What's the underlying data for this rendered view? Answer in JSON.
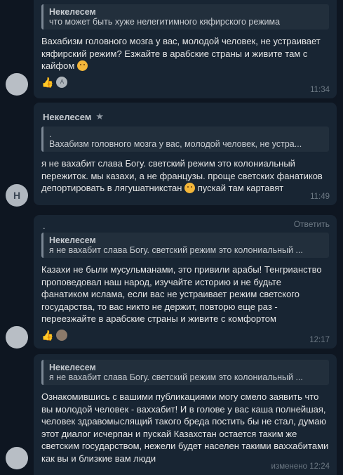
{
  "messages": [
    {
      "quote_name": "Некелесем",
      "quote_text": "что может быть хуже нелегитимного кяфирского режима",
      "text": "Вахабизм головного мозга у вас, молодой человек, не устраивает кяфирский режим? Езжайте в арабские страны и живите там с кайфом",
      "emoji": "winking-face",
      "time": "11:34",
      "reactions": [
        "👍",
        "A"
      ]
    },
    {
      "sender": "Некелесем",
      "quote_line1": ".",
      "quote_text": "Вахабизм головного мозга у вас, молодой человек, не устра...",
      "text": "я не вахабит слава Богу. светский режим это колониальный пережиток. мы казахи, а не французы. проще светских фанатиков депортировать в лягушатникстан",
      "text_after_emoji": "пускай там картавят",
      "time": "11:49",
      "avatar_letter": "Н"
    },
    {
      "reply_action": "Ответить",
      "top_dot": ".",
      "quote_name": "Некелесем",
      "quote_text": "я не вахабит слава Богу. светский режим это колониальный ...",
      "text": "Казахи не были мусульманами, это привили арабы! Тенгрианство проповедовал наш народ, изучайте историю и не будьте фанатиком ислама, если вас не устраивает режим светского государства, то вас никто не держит, повторю еще раз - переезжайте в арабские страны и живите с комфортом",
      "time": "12:17",
      "reactions": [
        "👍"
      ]
    },
    {
      "quote_name": "Некелесем",
      "quote_text": "я не вахабит слава Богу. светский режим это колониальный ...",
      "text": "Ознакомившись с вашими публикациями могу смело заявить что вы молодой человек - ваххабит! И в голове у вас каша полнейшая, человек здравомыслящий такого бреда постить бы не стал, думаю этот диалог исчерпан и пускай Казахстан остается таким же светским государством, нежели будет населен такими ваххабитами как вы и близкие вам люди",
      "time": "изменено 12:24"
    }
  ]
}
